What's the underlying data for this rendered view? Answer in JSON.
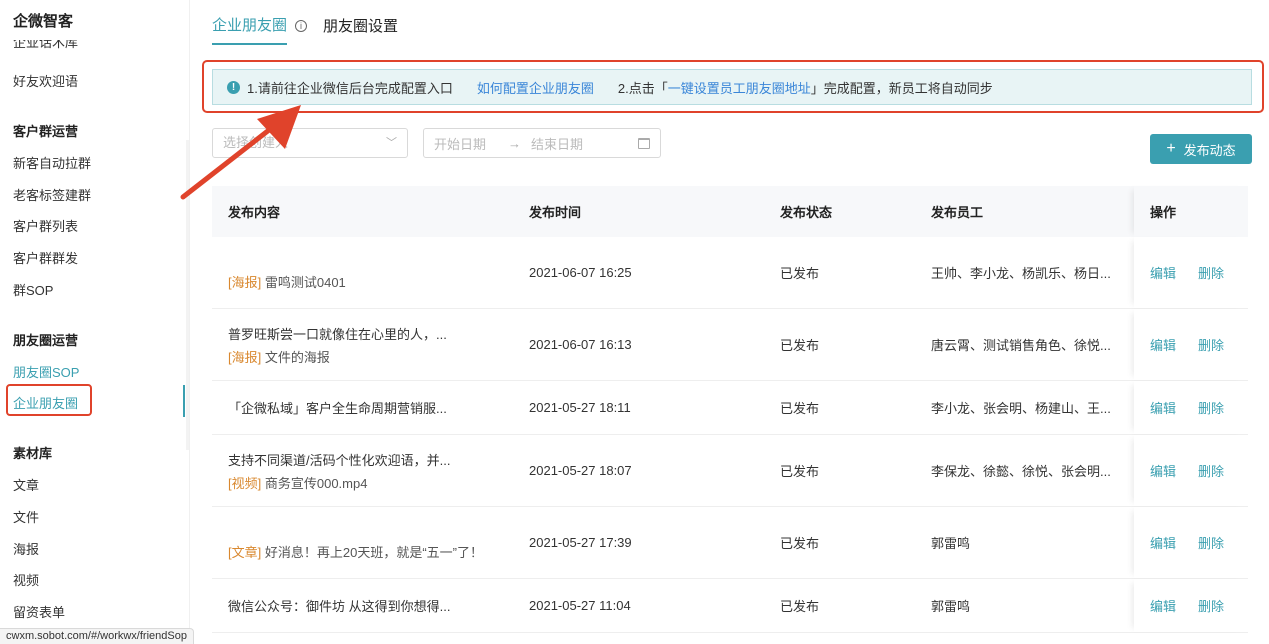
{
  "sidebar": {
    "brand": "企微智客",
    "cut_item": "企业话术库",
    "welcome": "好友欢迎语",
    "groups": [
      {
        "title": "客户群运营",
        "items": [
          "新客自动拉群",
          "老客标签建群",
          "客户群列表",
          "客户群群发",
          "群SOP"
        ]
      },
      {
        "title": "朋友圈运营",
        "items": [
          "朋友圈SOP",
          "企业朋友圈"
        ]
      },
      {
        "title": "素材库",
        "items": [
          "文章",
          "文件",
          "海报",
          "视频",
          "留资表单"
        ]
      }
    ]
  },
  "status_url": "cwxm.sobot.com/#/workwx/friendSop",
  "tabs": [
    "企业朋友圈",
    "朋友圈设置"
  ],
  "notice": {
    "icon": "!",
    "step1": "1.请前往企业微信后台完成配置入口",
    "link1": "如何配置企业朋友圈",
    "step2_prefix": "2.点击「",
    "link2": "一键设置员工朋友圈地址",
    "step2_suffix": "」完成配置，新员工将自动同步"
  },
  "filters": {
    "creator_placeholder": "选择创建人",
    "start_date": "开始日期",
    "end_date": "结束日期",
    "arrow": "→"
  },
  "publish_button": {
    "plus": "+",
    "label": "发布动态"
  },
  "table": {
    "headers": [
      "发布内容",
      "发布时间",
      "发布状态",
      "发布员工",
      "操作"
    ],
    "edit": "编辑",
    "delete": "删除",
    "rows": [
      {
        "line1": "",
        "tag": "[海报]",
        "sub": "雷鸣测试0401",
        "time": "2021-06-07 16:25",
        "status": "已发布",
        "staff": "王帅、李小龙、杨凯乐、杨日..."
      },
      {
        "line1": "普罗旺斯尝一口就像住在心里的人，...",
        "tag": "[海报]",
        "sub": "文件的海报",
        "time": "2021-06-07 16:13",
        "status": "已发布",
        "staff": "唐云霄、测试销售角色、徐悦..."
      },
      {
        "line1": "「企微私域」客户全生命周期营销服...",
        "tag": "",
        "sub": "",
        "time": "2021-05-27 18:11",
        "status": "已发布",
        "staff": "李小龙、张会明、杨建山、王..."
      },
      {
        "line1": "支持不同渠道/活码个性化欢迎语，并...",
        "tag": "[视频]",
        "sub": "商务宣传000.mp4",
        "time": "2021-05-27 18:07",
        "status": "已发布",
        "staff": "李保龙、徐懿、徐悦、张会明..."
      },
      {
        "line1": "",
        "tag": "[文章]",
        "sub": "好消息！再上20天班，就是“五一”了！",
        "time": "2021-05-27 17:39",
        "status": "已发布",
        "staff": "郭雷鸣"
      },
      {
        "line1": "微信公众号：御件坊 从这得到你想得...",
        "tag": "",
        "sub": "",
        "time": "2021-05-27 11:04",
        "status": "已发布",
        "staff": "郭雷鸣"
      }
    ]
  }
}
